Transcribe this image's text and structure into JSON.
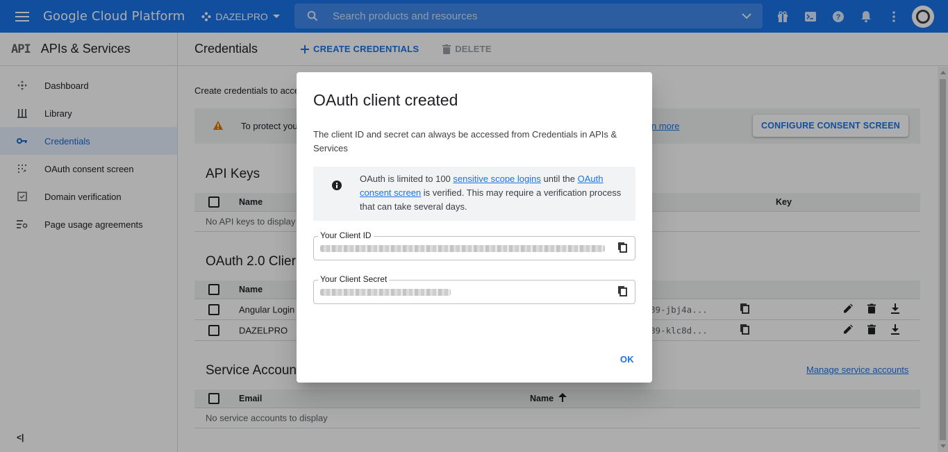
{
  "topbar": {
    "brand": "Google Cloud Platform",
    "project": "DAZELPRO",
    "search_placeholder": "Search products and resources"
  },
  "sidebar": {
    "logo": "API",
    "title": "APIs & Services",
    "items": [
      {
        "label": "Dashboard",
        "icon": "dashboard-icon"
      },
      {
        "label": "Library",
        "icon": "library-icon"
      },
      {
        "label": "Credentials",
        "icon": "key-icon",
        "active": true
      },
      {
        "label": "OAuth consent screen",
        "icon": "consent-icon"
      },
      {
        "label": "Domain verification",
        "icon": "checkbox-icon"
      },
      {
        "label": "Page usage agreements",
        "icon": "settings-list-icon"
      }
    ],
    "collapse": "<|"
  },
  "main": {
    "title": "Credentials",
    "create_label": "CREATE CREDENTIALS",
    "delete_label": "DELETE",
    "intro": "Create credentials to acce",
    "warning_text": "To protect you",
    "warning_link": "n more",
    "configure_button": "CONFIGURE CONSENT SCREEN",
    "api_keys": {
      "title": "API Keys",
      "col_name": "Name",
      "col_key": "Key",
      "empty": "No API keys to display"
    },
    "oauth": {
      "title": "OAuth 2.0 Clier",
      "col_name": "Name",
      "rows": [
        {
          "name": "Angular Login",
          "client_id": "89-jbj4a..."
        },
        {
          "name": "DAZELPRO",
          "client_id": "89-klc8d..."
        }
      ]
    },
    "service": {
      "title": "Service Accoun",
      "manage_link": "Manage service accounts",
      "col_email": "Email",
      "col_name": "Name",
      "empty": "No service accounts to display"
    }
  },
  "dialog": {
    "title": "OAuth client created",
    "description": "The client ID and secret can always be accessed from Credentials in APIs & Services",
    "info_part1": "OAuth is limited to 100 ",
    "info_link1": "sensitive scope logins",
    "info_part2": " until the ",
    "info_link2": "OAuth consent screen",
    "info_part3": " is verified. This may require a verification process that can take several days.",
    "client_id_label": "Your Client ID",
    "client_secret_label": "Your Client Secret",
    "ok_label": "OK"
  },
  "colors": {
    "brand_blue": "#1a73e8",
    "overlay": "rgba(0,0,0,0.32)",
    "warning": "#e37400"
  }
}
